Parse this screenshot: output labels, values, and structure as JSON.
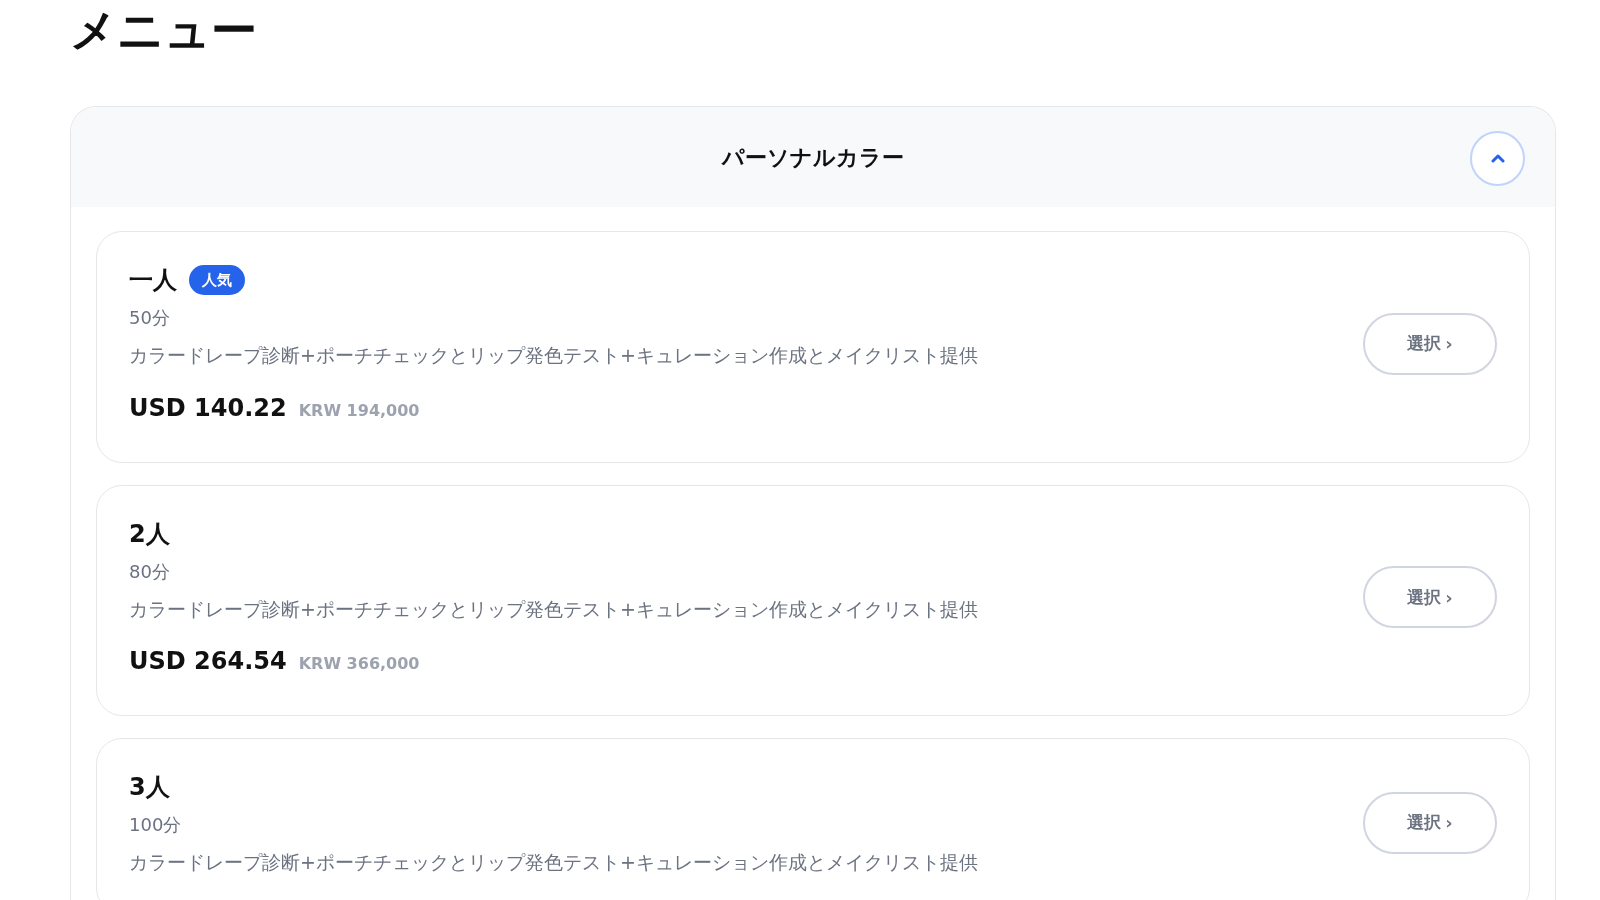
{
  "page_title": "メニュー",
  "section": {
    "title": "パーソナルカラー",
    "expanded": true,
    "items": [
      {
        "name": "一人",
        "badge": "人気",
        "duration": "50分",
        "description": "カラードレープ診断+ポーチチェックとリップ発色テスト+キュレーション作成とメイクリスト提供",
        "price": "USD 140.22",
        "price_local": "KRW 194,000",
        "button": "選択",
        "button_chevron": "›"
      },
      {
        "name": "2人",
        "duration": "80分",
        "description": "カラードレープ診断+ポーチチェックとリップ発色テスト+キュレーション作成とメイクリスト提供",
        "price": "USD 264.54",
        "price_local": "KRW 366,000",
        "button": "選択",
        "button_chevron": "›"
      },
      {
        "name": "3人",
        "duration": "100分",
        "description": "カラードレープ診断+ポーチチェックとリップ発色テスト+キュレーション作成とメイクリスト提供",
        "button": "選択",
        "button_chevron": "›"
      }
    ]
  }
}
